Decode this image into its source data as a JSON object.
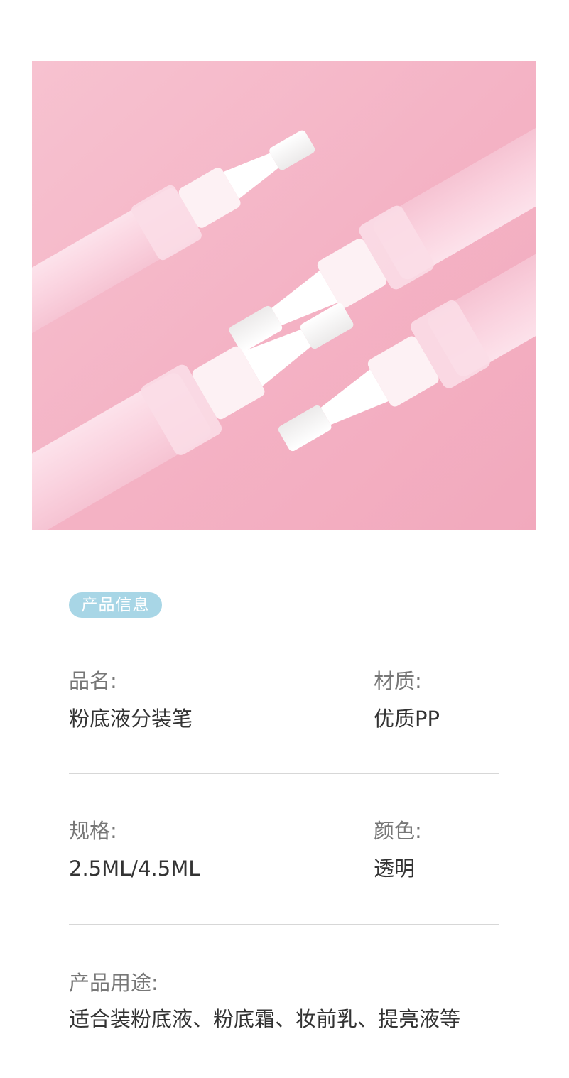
{
  "photo": {
    "subject": "pink-background-brush-pens"
  },
  "section_badge": "产品信息",
  "specs": {
    "name": {
      "label": "品名:",
      "value": "粉底液分装笔"
    },
    "material": {
      "label": "材质:",
      "value": "优质PP"
    },
    "size": {
      "label": "规格:",
      "value": "2.5ML/4.5ML"
    },
    "color": {
      "label": "颜色:",
      "value": "透明"
    },
    "usage": {
      "label": "产品用途:",
      "value": "适合装粉底液、粉底霜、妆前乳、提亮液等"
    }
  },
  "colors": {
    "badge_bg": "#a8d6e6",
    "photo_bg": "#f5b8c8",
    "label_text": "#777777",
    "value_text": "#333333",
    "divider": "#d7d7d7"
  }
}
